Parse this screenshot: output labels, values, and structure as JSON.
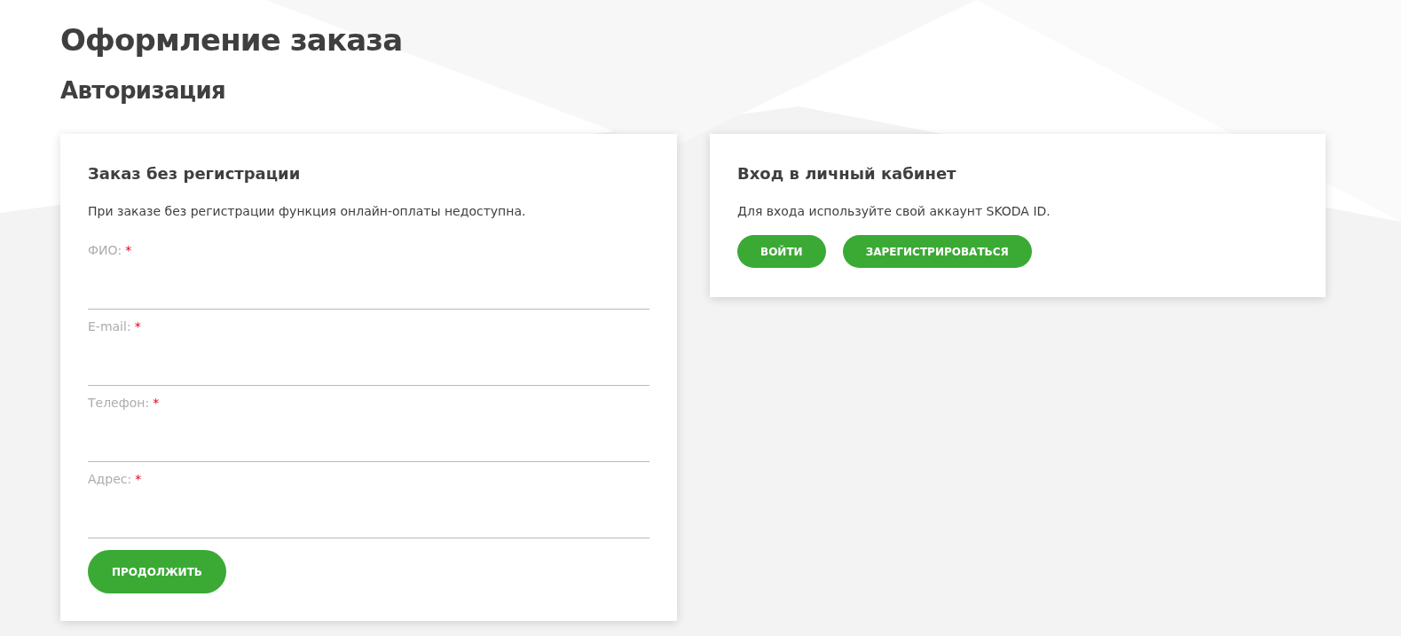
{
  "page_title": "Оформление заказа",
  "section_title": "Авторизация",
  "guest_card": {
    "title": "Заказ без регистрации",
    "note": "При заказе без регистрации функция онлайн-оплаты недоступна.",
    "fields": [
      {
        "label": "ФИО:",
        "required_mark": "*"
      },
      {
        "label": "E-mail:",
        "required_mark": "*"
      },
      {
        "label": "Телефон:",
        "required_mark": "*"
      },
      {
        "label": "Адрес:",
        "required_mark": "*"
      }
    ],
    "button": "ПРОДОЛЖИТЬ"
  },
  "login_card": {
    "title": "Вход в личный кабинет",
    "note": "Для входа используйте свой аккаунт SKODA ID.",
    "buttons": [
      "ВОЙТИ",
      "ЗАРЕГИСТРИРОВАТЬСЯ"
    ]
  }
}
